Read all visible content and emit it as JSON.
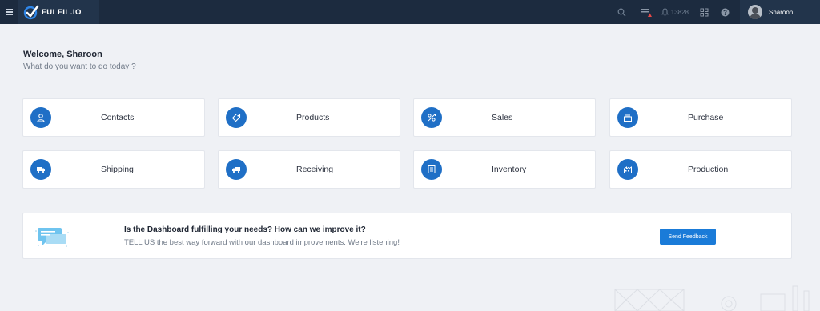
{
  "app": {
    "brand": "FULFIL.IO",
    "notification_count": "13828"
  },
  "user": {
    "name": "Sharoon"
  },
  "welcome": {
    "title": "Welcome, Sharoon",
    "subtitle": "What do you want to do today ?"
  },
  "tiles": [
    {
      "label": "Contacts",
      "icon": "contacts-icon"
    },
    {
      "label": "Products",
      "icon": "tag-icon"
    },
    {
      "label": "Sales",
      "icon": "sales-icon"
    },
    {
      "label": "Purchase",
      "icon": "purchase-icon"
    },
    {
      "label": "Shipping",
      "icon": "truck-icon"
    },
    {
      "label": "Receiving",
      "icon": "receiving-truck-icon"
    },
    {
      "label": "Inventory",
      "icon": "inventory-icon"
    },
    {
      "label": "Production",
      "icon": "factory-icon"
    }
  ],
  "feedback": {
    "title": "Is the Dashboard fulfilling your needs? How can we improve it?",
    "text": "TELL US the best way forward with our dashboard improvements. We're listening!",
    "button_label": "Send Feedback"
  },
  "colors": {
    "topbar": "#1c2b3f",
    "accent": "#1f6fc6",
    "background": "#eff1f5",
    "button": "#1a7bd8"
  }
}
